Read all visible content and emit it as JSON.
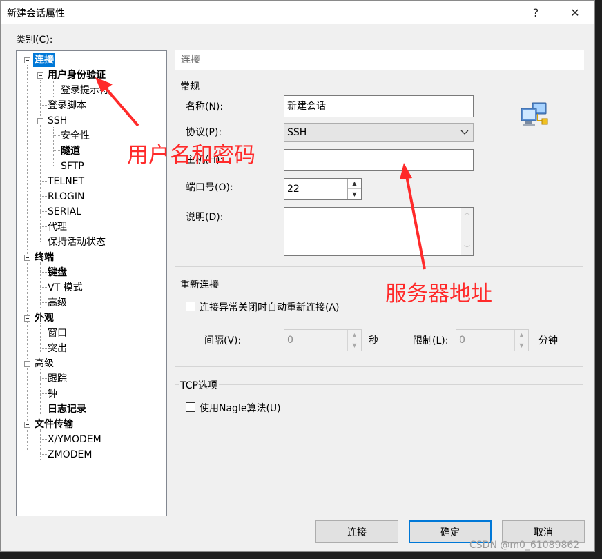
{
  "window": {
    "title": "新建会话属性",
    "help_glyph": "?",
    "close_glyph": "✕"
  },
  "category_label": "类别(C):",
  "tree": [
    {
      "label": "连接",
      "bold": true,
      "selected": true
    },
    {
      "label": "用户身份验证",
      "bold": true
    },
    {
      "label": "登录提示符"
    },
    {
      "label": "登录脚本"
    },
    {
      "label": "SSH"
    },
    {
      "label": "安全性"
    },
    {
      "label": "隧道",
      "bold": true
    },
    {
      "label": "SFTP"
    },
    {
      "label": "TELNET"
    },
    {
      "label": "RLOGIN"
    },
    {
      "label": "SERIAL"
    },
    {
      "label": "代理"
    },
    {
      "label": "保持活动状态"
    },
    {
      "label": "终端",
      "bold": true
    },
    {
      "label": "键盘",
      "bold": true
    },
    {
      "label": "VT 模式"
    },
    {
      "label": "高级"
    },
    {
      "label": "外观",
      "bold": true
    },
    {
      "label": "窗口"
    },
    {
      "label": "突出"
    },
    {
      "label": "高级"
    },
    {
      "label": "跟踪"
    },
    {
      "label": "钟"
    },
    {
      "label": "日志记录",
      "bold": true
    },
    {
      "label": "文件传输",
      "bold": true
    },
    {
      "label": "X/YMODEM"
    },
    {
      "label": "ZMODEM"
    }
  ],
  "panel": {
    "header": "连接",
    "general": {
      "title": "常规",
      "name_label": "名称(N):",
      "name_value": "新建会话",
      "protocol_label": "协议(P):",
      "protocol_value": "SSH",
      "host_label": "主机(H):",
      "host_value": "",
      "port_label": "端口号(O):",
      "port_value": "22",
      "desc_label": "说明(D):",
      "desc_value": ""
    },
    "reconnect": {
      "title": "重新连接",
      "auto_label": "连接异常关闭时自动重新连接(A)",
      "auto_checked": false,
      "interval_label": "间隔(V):",
      "interval_value": "0",
      "seconds": "秒",
      "limit_label": "限制(L):",
      "limit_value": "0",
      "minutes": "分钟"
    },
    "tcp": {
      "title": "TCP选项",
      "nagle_label": "使用Nagle算法(U)",
      "nagle_checked": false
    }
  },
  "buttons": {
    "connect": "连接",
    "ok": "确定",
    "cancel": "取消"
  },
  "annotations": {
    "credentials": "用户名和密码",
    "server": "服务器地址",
    "color": "#ff2a2a"
  },
  "watermark": "CSDN @m0_61089862",
  "icons": {
    "computer": "network-computer-icon",
    "combo": "chevron-down-icon"
  }
}
